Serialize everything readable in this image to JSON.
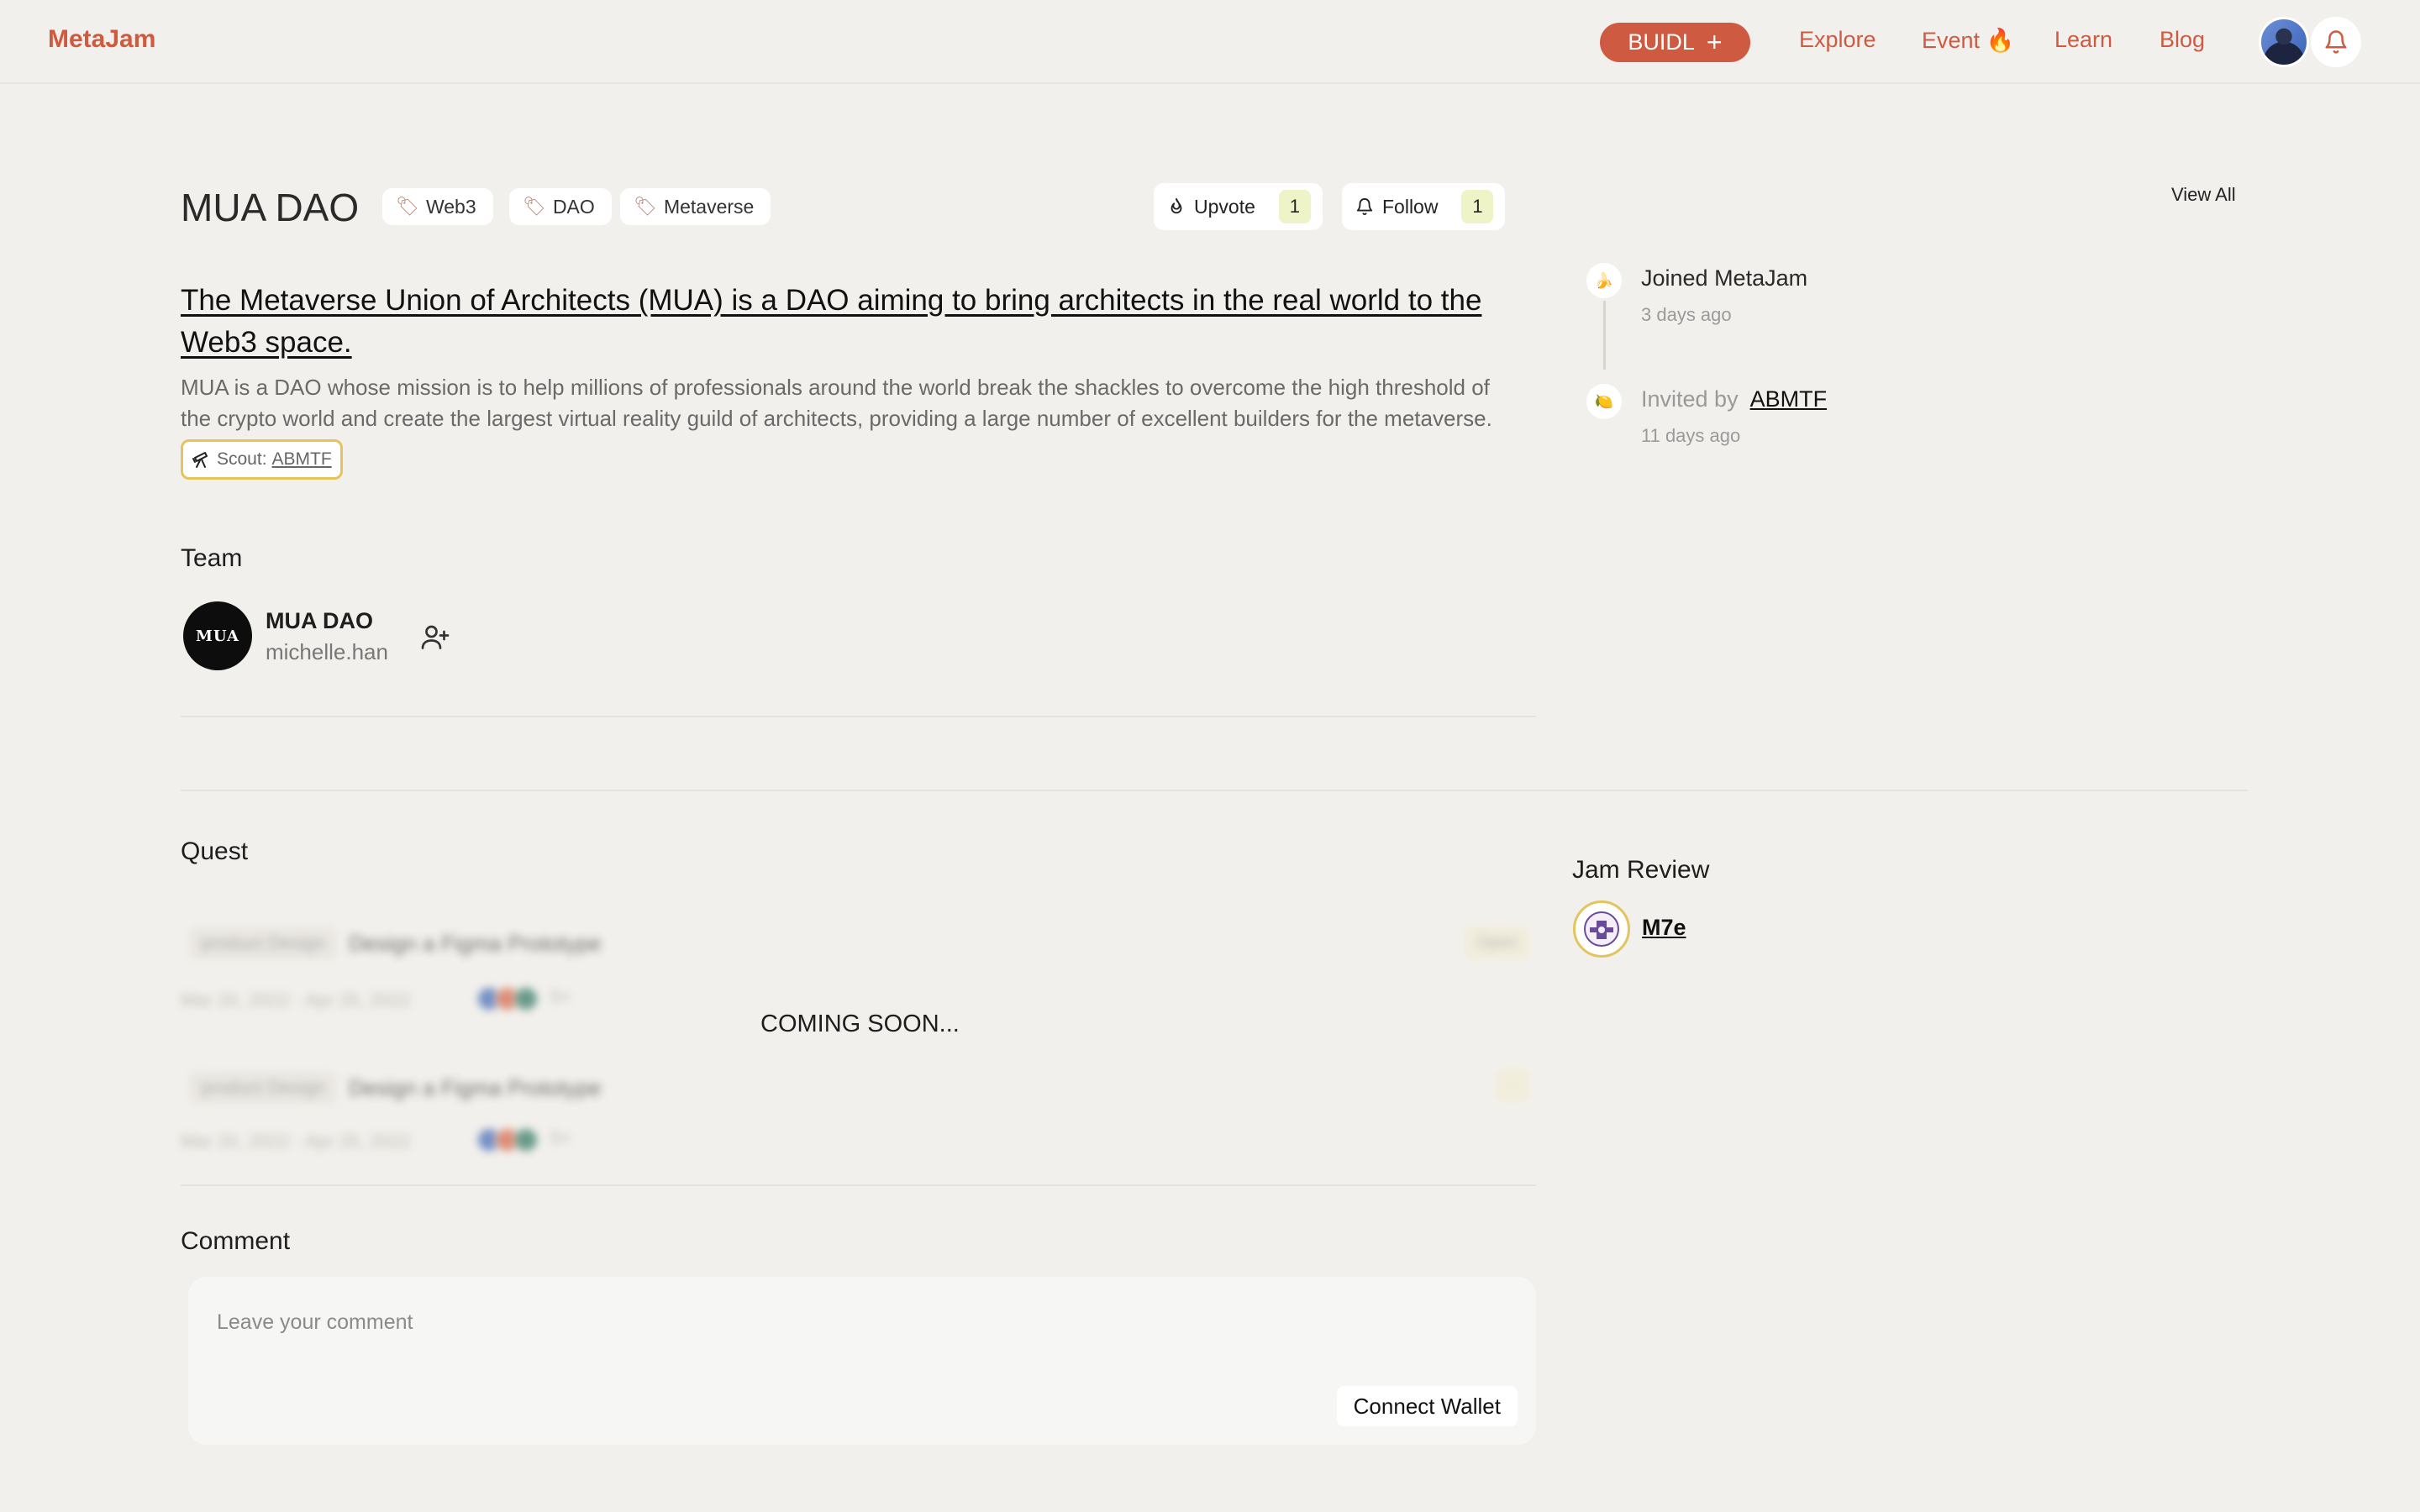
{
  "nav": {
    "logo": "MetaJam",
    "buidl_label": "BUIDL",
    "links": [
      "Explore",
      "Event 🔥",
      "Learn",
      "Blog"
    ]
  },
  "project": {
    "title": "MUA DAO",
    "tags": [
      "Web3",
      "DAO",
      "Metaverse"
    ],
    "upvote_label": "Upvote",
    "upvote_count": "1",
    "follow_label": "Follow",
    "follow_count": "1",
    "headline": "The Metaverse Union of Architects (MUA) is a DAO aiming to bring architects in the real world to the Web3 space.",
    "description": "MUA is a DAO whose mission is to help millions of professionals around the world break the shackles to overcome the high threshold of the crypto world and create the largest virtual reality guild of architects, providing a large number of excellent builders for the metaverse.",
    "scout_label": "Scout:",
    "scout_name": "ABMTF"
  },
  "team": {
    "heading": "Team",
    "logo_text": "MUA",
    "name": "MUA DAO",
    "user": "michelle.han"
  },
  "quest": {
    "heading": "Quest",
    "overlay": "COMING SOON...",
    "rows": [
      {
        "chip": "product Design",
        "title": "Design a Figma Prototype",
        "date": "Mar 20, 2022 - Apr 20, 2022",
        "count": "5+",
        "status": "Open"
      },
      {
        "chip": "product Design",
        "title": "Design a Figma Prototype",
        "date": "Mar 20, 2022 - Apr 20, 2022",
        "count": "5+",
        "status": ""
      }
    ]
  },
  "comment": {
    "heading": "Comment",
    "placeholder": "Leave your comment",
    "connect_label": "Connect Wallet"
  },
  "activity": {
    "view_all": "View All",
    "items": [
      {
        "icon": "🍌",
        "text": "Joined MetaJam",
        "time": "3 days ago"
      },
      {
        "icon": "🍋",
        "prefix": "Invited by",
        "link": "ABMTF",
        "time": "11 days ago"
      }
    ]
  },
  "review": {
    "heading": "Jam Review",
    "reviewer": "M7e"
  },
  "colors": {
    "background": "#f2f0ec",
    "accent": "#cf5a42",
    "badge": "#eef3c8",
    "scout_border": "#e4c45d"
  }
}
